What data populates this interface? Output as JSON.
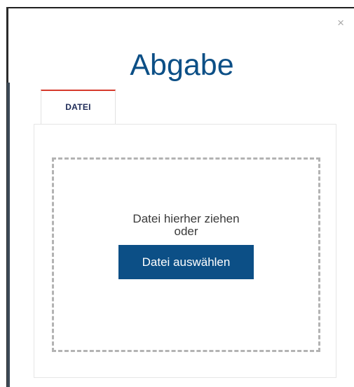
{
  "dialog": {
    "title": "Abgabe",
    "close_label": "×"
  },
  "tabs": [
    {
      "label": "DATEI",
      "active": true
    }
  ],
  "dropzone": {
    "instruction_line1": "Datei hierher ziehen",
    "instruction_line2": "oder",
    "button_label": "Datei auswählen"
  },
  "colors": {
    "accent": "#0c4f86",
    "tab_indicator": "#d63a2c",
    "dash_border": "#b3b3b3"
  }
}
